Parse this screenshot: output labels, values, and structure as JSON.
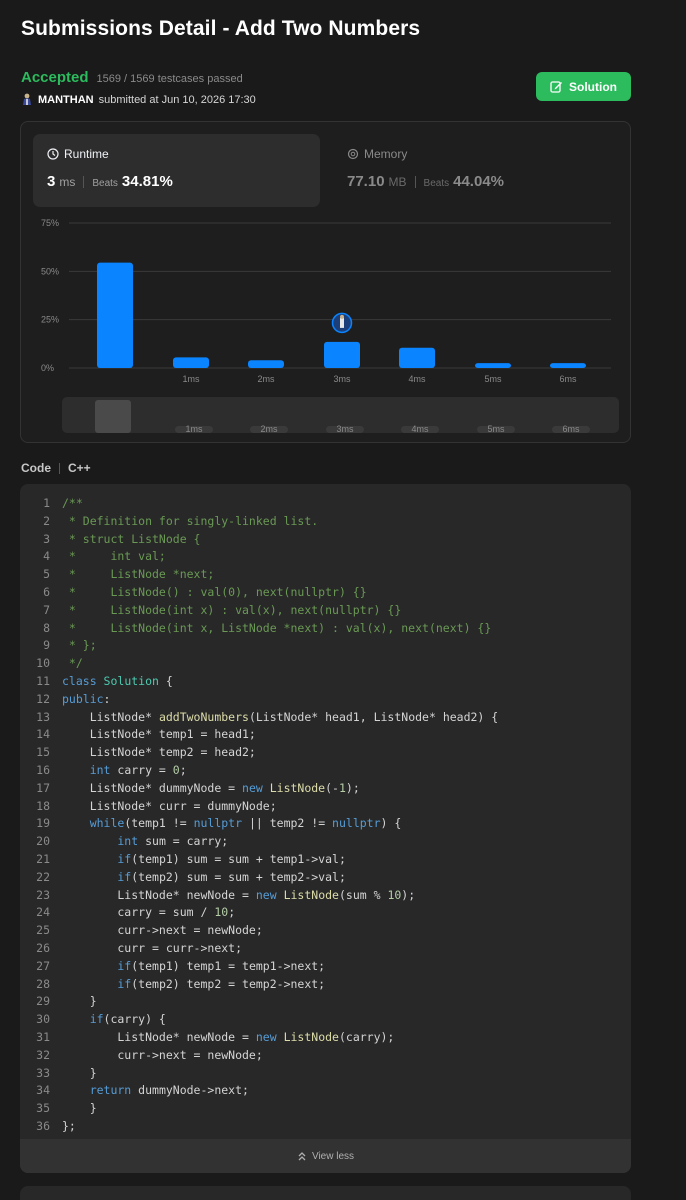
{
  "page": {
    "title": "Submissions Detail - Add Two Numbers"
  },
  "status": {
    "verdict": "Accepted",
    "testcases": "1569 / 1569 testcases passed"
  },
  "submission": {
    "user": "MANTHAN",
    "submitted_text": "submitted at Jun 10, 2026 17:30"
  },
  "solution_button": {
    "label": "Solution",
    "color": "#2cbb5d"
  },
  "runtime": {
    "label": "Runtime",
    "value": "3",
    "unit": "ms",
    "beats_label": "Beats",
    "beats": "34.81%"
  },
  "memory": {
    "label": "Memory",
    "value": "77.10",
    "unit": "MB",
    "beats_label": "Beats",
    "beats": "44.04%"
  },
  "chart_data": {
    "type": "bar",
    "y_ticks": [
      "75%",
      "50%",
      "25%",
      "0%"
    ],
    "ylim": [
      0,
      75
    ],
    "categories": [
      "",
      "1ms",
      "2ms",
      "3ms",
      "4ms",
      "5ms",
      "6ms"
    ],
    "values": [
      54.5,
      5.5,
      4,
      13.5,
      10.5,
      2.5,
      2.5
    ],
    "highlight_category": "3ms",
    "bar_color": "#0a84ff",
    "grid": true
  },
  "code_header": {
    "label": "Code",
    "language": "C++"
  },
  "code": {
    "lines": [
      [
        [
          "c",
          "/**"
        ]
      ],
      [
        [
          "c",
          " * Definition for singly-linked list."
        ]
      ],
      [
        [
          "c",
          " * struct ListNode {"
        ]
      ],
      [
        [
          "c",
          " *     int val;"
        ]
      ],
      [
        [
          "c",
          " *     ListNode *next;"
        ]
      ],
      [
        [
          "c",
          " *     ListNode() : val(0), next(nullptr) {}"
        ]
      ],
      [
        [
          "c",
          " *     ListNode(int x) : val(x), next(nullptr) {}"
        ]
      ],
      [
        [
          "c",
          " *     ListNode(int x, ListNode *next) : val(x), next(next) {}"
        ]
      ],
      [
        [
          "c",
          " * };"
        ]
      ],
      [
        [
          "c",
          " */"
        ]
      ],
      [
        [
          "k",
          "class "
        ],
        [
          "t",
          "Solution"
        ],
        [
          "p",
          " {"
        ]
      ],
      [
        [
          "k",
          "public"
        ],
        [
          "p",
          ":"
        ]
      ],
      [
        [
          "p",
          "    ListNode* "
        ],
        [
          "f",
          "addTwoNumbers"
        ],
        [
          "p",
          "(ListNode* head1, ListNode* head2) {"
        ]
      ],
      [
        [
          "p",
          "    ListNode* temp1 = head1;"
        ]
      ],
      [
        [
          "p",
          "    ListNode* temp2 = head2;"
        ]
      ],
      [
        [
          "k",
          "    int"
        ],
        [
          "p",
          " carry = "
        ],
        [
          "n",
          "0"
        ],
        [
          "p",
          ";"
        ]
      ],
      [
        [
          "p",
          "    ListNode* dummyNode = "
        ],
        [
          "k",
          "new "
        ],
        [
          "f",
          "ListNode"
        ],
        [
          "p",
          "(-"
        ],
        [
          "n",
          "1"
        ],
        [
          "p",
          ");"
        ]
      ],
      [
        [
          "p",
          "    ListNode* curr = dummyNode;"
        ]
      ],
      [
        [
          "k",
          "    while"
        ],
        [
          "p",
          "(temp1 != "
        ],
        [
          "k",
          "nullptr"
        ],
        [
          "p",
          " || temp2 != "
        ],
        [
          "k",
          "nullptr"
        ],
        [
          "p",
          ") {"
        ]
      ],
      [
        [
          "k",
          "        int"
        ],
        [
          "p",
          " sum = carry;"
        ]
      ],
      [
        [
          "k",
          "        if"
        ],
        [
          "p",
          "(temp1) sum = sum + temp1->val;"
        ]
      ],
      [
        [
          "k",
          "        if"
        ],
        [
          "p",
          "(temp2) sum = sum + temp2->val;"
        ]
      ],
      [
        [
          "p",
          "        ListNode* newNode = "
        ],
        [
          "k",
          "new "
        ],
        [
          "f",
          "ListNode"
        ],
        [
          "p",
          "(sum % "
        ],
        [
          "n",
          "10"
        ],
        [
          "p",
          ");"
        ]
      ],
      [
        [
          "p",
          "        carry = sum / "
        ],
        [
          "n",
          "10"
        ],
        [
          "p",
          ";"
        ]
      ],
      [
        [
          "p",
          "        curr->next = newNode;"
        ]
      ],
      [
        [
          "p",
          "        curr = curr->next;"
        ]
      ],
      [
        [
          "k",
          "        if"
        ],
        [
          "p",
          "(temp1) temp1 = temp1->next;"
        ]
      ],
      [
        [
          "k",
          "        if"
        ],
        [
          "p",
          "(temp2) temp2 = temp2->next;"
        ]
      ],
      [
        [
          "p",
          "    }"
        ]
      ],
      [
        [
          "k",
          "    if"
        ],
        [
          "p",
          "(carry) {"
        ]
      ],
      [
        [
          "p",
          "        ListNode* newNode = "
        ],
        [
          "k",
          "new "
        ],
        [
          "f",
          "ListNode"
        ],
        [
          "p",
          "(carry);"
        ]
      ],
      [
        [
          "p",
          "        curr->next = newNode;"
        ]
      ],
      [
        [
          "p",
          "    }"
        ]
      ],
      [
        [
          "k",
          "    return"
        ],
        [
          "p",
          " dummyNode->next;"
        ]
      ],
      [
        [
          "p",
          "    }"
        ]
      ],
      [
        [
          "p",
          "};"
        ]
      ]
    ]
  },
  "view_less": {
    "label": "View less"
  }
}
